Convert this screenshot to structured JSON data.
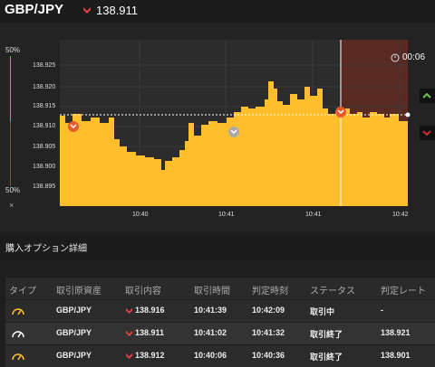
{
  "header": {
    "pair": "GBP/JPY",
    "price": "138.911",
    "direction_icon": "down-arrow-icon"
  },
  "chart": {
    "pct_top": "50%",
    "pct_bottom": "50%",
    "close_label": "×",
    "timer": "00:06",
    "y_ticks": [
      "138.925",
      "138.920",
      "138.915",
      "138.910",
      "138.905",
      "138.900",
      "138.895"
    ],
    "x_ticks": [
      "10:40",
      "10:41",
      "10:41",
      "10:42"
    ],
    "colors": {
      "area": "#ffbf2c",
      "expired_zone": "#5a2a22",
      "up": "#6cc04a",
      "down": "#c83030"
    }
  },
  "details": {
    "title": "購入オプション詳細",
    "columns": [
      "タイプ",
      "取引原資産",
      "取引内容",
      "取引時間",
      "判定時刻",
      "ステータス",
      "判定レート"
    ],
    "rows": [
      {
        "type_icon": "gauge-icon",
        "asset": "GBP/JPY",
        "direction_icon": "down-arrow-icon",
        "content": "138.916",
        "time": "10:41:39",
        "judge_time": "10:42:09",
        "status": "取引中",
        "rate": "-"
      },
      {
        "type_icon": "gauge-icon",
        "asset": "GBP/JPY",
        "direction_icon": "down-arrow-icon",
        "content": "138.911",
        "time": "10:41:02",
        "judge_time": "10:41:32",
        "status": "取引終了",
        "rate": "138.921"
      },
      {
        "type_icon": "gauge-icon",
        "asset": "GBP/JPY",
        "direction_icon": "down-arrow-icon",
        "content": "138.912",
        "time": "10:40:06",
        "judge_time": "10:40:36",
        "status": "取引終了",
        "rate": "138.901"
      }
    ]
  }
}
